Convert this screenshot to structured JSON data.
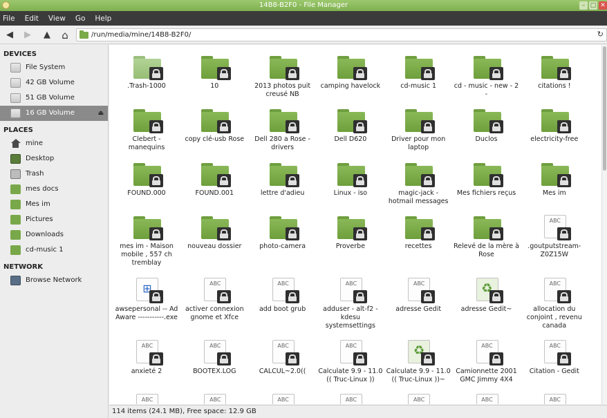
{
  "window": {
    "title": "14B8-B2F0 - File Manager"
  },
  "menu": [
    "File",
    "Edit",
    "View",
    "Go",
    "Help"
  ],
  "location": {
    "path": "/run/media/mine/14B8-B2F0/"
  },
  "sidebar": {
    "devices_heading": "DEVICES",
    "devices": [
      {
        "label": "File System",
        "icon": "drive-icon"
      },
      {
        "label": "42 GB Volume",
        "icon": "drive-icon"
      },
      {
        "label": "51 GB Volume",
        "icon": "drive-icon"
      },
      {
        "label": "16 GB Volume",
        "icon": "drive-icon",
        "selected": true,
        "eject": "⏏"
      }
    ],
    "places_heading": "PLACES",
    "places": [
      {
        "label": "mine",
        "icon": "home-icon"
      },
      {
        "label": "Desktop",
        "icon": "desktop-icon"
      },
      {
        "label": "Trash",
        "icon": "trash-icon"
      },
      {
        "label": "mes docs",
        "icon": "folder-icon"
      },
      {
        "label": "Mes im",
        "icon": "folder-icon"
      },
      {
        "label": "Pictures",
        "icon": "pictures-folder-icon"
      },
      {
        "label": "Downloads",
        "icon": "downloads-folder-icon"
      },
      {
        "label": "cd-music 1",
        "icon": "folder-icon"
      }
    ],
    "network_heading": "NETWORK",
    "network": [
      {
        "label": "Browse Network",
        "icon": "network-icon"
      }
    ]
  },
  "files": [
    {
      "name": ".Trash-1000",
      "type": "folder-light"
    },
    {
      "name": "10",
      "type": "folder"
    },
    {
      "name": "2013 photos puit creusé NB",
      "type": "folder"
    },
    {
      "name": "camping havelock",
      "type": "folder"
    },
    {
      "name": "cd-music 1",
      "type": "folder"
    },
    {
      "name": "cd - music - new - 2 -",
      "type": "folder"
    },
    {
      "name": "citations  !",
      "type": "folder"
    },
    {
      "name": "Clebert - manequins",
      "type": "folder"
    },
    {
      "name": "copy clé-usb Rose",
      "type": "folder"
    },
    {
      "name": "Dell 280 a Rose - drivers",
      "type": "folder"
    },
    {
      "name": "Dell D620",
      "type": "folder"
    },
    {
      "name": "Driver pour mon laptop",
      "type": "folder"
    },
    {
      "name": "Duclos",
      "type": "folder"
    },
    {
      "name": "electricity-free",
      "type": "folder"
    },
    {
      "name": "FOUND.000",
      "type": "folder"
    },
    {
      "name": "FOUND.001",
      "type": "folder"
    },
    {
      "name": "lettre d'adieu",
      "type": "folder"
    },
    {
      "name": "Linux - iso",
      "type": "folder"
    },
    {
      "name": "magic-jack - hotmail messages",
      "type": "folder"
    },
    {
      "name": "Mes fichiers reçus",
      "type": "folder"
    },
    {
      "name": "Mes im",
      "type": "folder"
    },
    {
      "name": "mes im - Maison mobile , 557 ch tremblay",
      "type": "folder"
    },
    {
      "name": "nouveau dossier",
      "type": "folder"
    },
    {
      "name": "photo-camera",
      "type": "folder"
    },
    {
      "name": "Proverbe",
      "type": "folder"
    },
    {
      "name": "recettes",
      "type": "folder"
    },
    {
      "name": "Relevé de la mère à Rose",
      "type": "folder"
    },
    {
      "name": ".goutputstream-Z0Z15W",
      "type": "text"
    },
    {
      "name": "awsepersonal  -- Ad Aware -----------.exe",
      "type": "exe"
    },
    {
      "name": "activer connexion gnome  et  Xfce",
      "type": "text"
    },
    {
      "name": "add  boot grub",
      "type": "text"
    },
    {
      "name": "adduser - alt-f2 - kdesu systemsettings",
      "type": "text"
    },
    {
      "name": "adresse Gedit",
      "type": "text"
    },
    {
      "name": "adresse Gedit~",
      "type": "recycle"
    },
    {
      "name": "allocation du conjoint , revenu canada",
      "type": "text"
    },
    {
      "name": "anxieté 2",
      "type": "text"
    },
    {
      "name": "BOOTEX.LOG",
      "type": "text"
    },
    {
      "name": "CALCUL~2.0((",
      "type": "text"
    },
    {
      "name": "Calculate 9.9 - 11.0 (( Truc-Linux ))",
      "type": "text"
    },
    {
      "name": "Calculate 9.9 - 11.0 (( Truc-Linux ))~",
      "type": "recycle"
    },
    {
      "name": "Camionnette 2001 GMC Jimmy  4X4",
      "type": "text"
    },
    {
      "name": "Citation - Gedit",
      "type": "text"
    },
    {
      "name": "",
      "type": "text"
    },
    {
      "name": "",
      "type": "text"
    },
    {
      "name": "",
      "type": "text"
    },
    {
      "name": "",
      "type": "text"
    },
    {
      "name": "",
      "type": "text"
    },
    {
      "name": "",
      "type": "text"
    },
    {
      "name": "",
      "type": "text"
    }
  ],
  "doc_badge": "ABC",
  "status": {
    "text": "114 items (24.1 MB), Free space: 12.9 GB"
  },
  "toolbar": {
    "back": "◀",
    "forward": "▶",
    "up": "▲",
    "home": "⌂",
    "reload": "↻"
  }
}
